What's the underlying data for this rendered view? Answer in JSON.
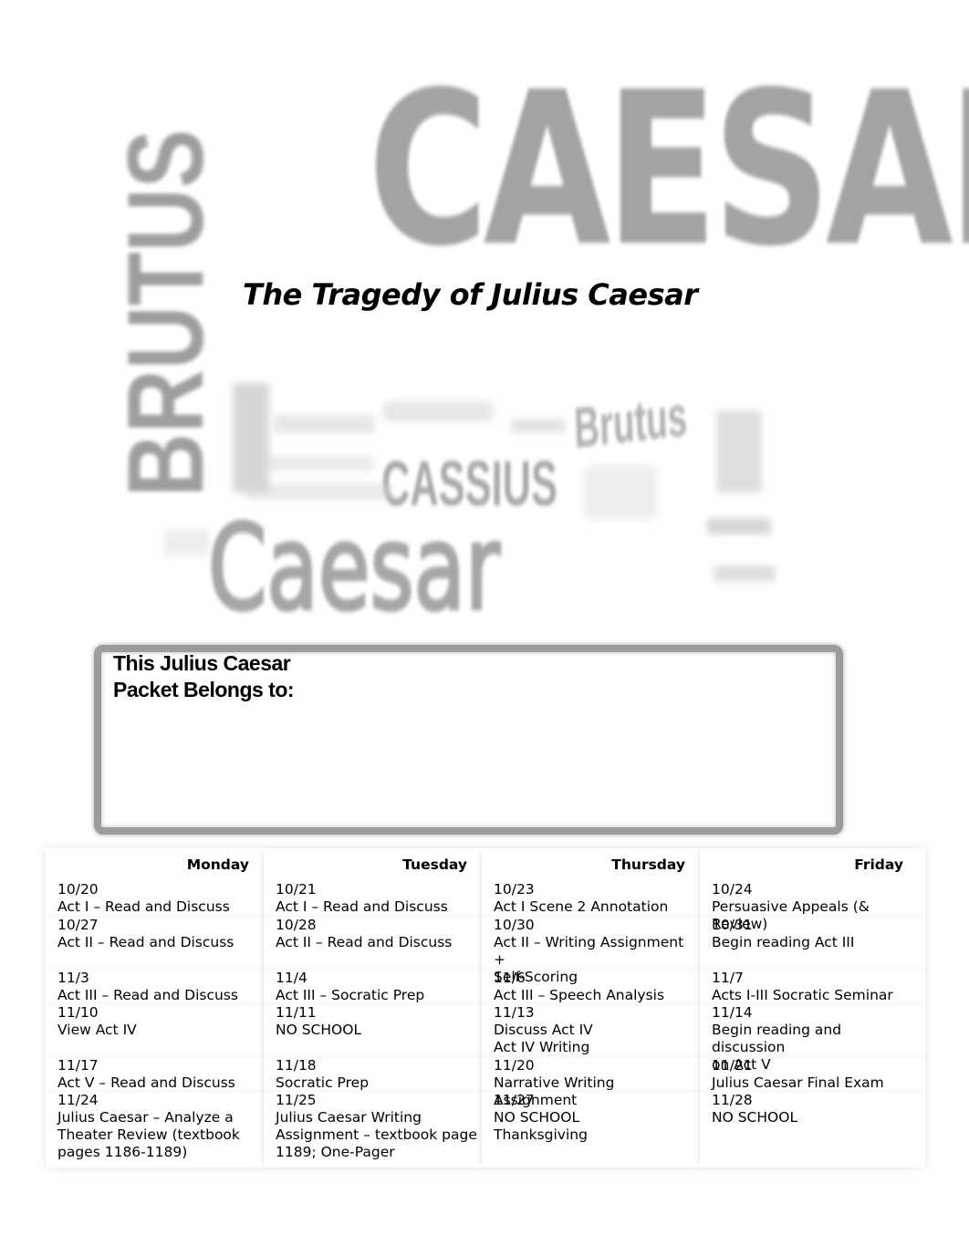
{
  "cover": {
    "word_cloud": {
      "large_top": "CAESAR",
      "vertical": "BRUTUS",
      "lower": "Caesar",
      "middle": "CASSIUS",
      "middle_small": "Brutus"
    },
    "title": "The Tragedy of Julius Caesar"
  },
  "name_box": {
    "label_line1": "This Julius Caesar",
    "label_line2": "Packet Belongs to:",
    "value": ""
  },
  "schedule": {
    "headers": [
      "Monday",
      "Tuesday",
      "Thursday",
      "Friday"
    ],
    "weeks": [
      {
        "days": [
          {
            "date": "10/20",
            "activity": "Act I – Read and Discuss"
          },
          {
            "date": "10/21",
            "activity": "Act I – Read and Discuss"
          },
          {
            "date": "10/23",
            "activity": "Act I Scene 2 Annotation"
          },
          {
            "date": "10/24",
            "activity": "Persuasive Appeals (& Review)"
          }
        ]
      },
      {
        "days": [
          {
            "date": "10/27",
            "activity": "Act II – Read and Discuss"
          },
          {
            "date": "10/28",
            "activity": "Act II – Read and Discuss"
          },
          {
            "date": "10/30",
            "activity": "Act II – Writing Assignment +\nSelf-Scoring"
          },
          {
            "date": "10/31",
            "activity": "Begin reading Act III"
          }
        ]
      },
      {
        "days": [
          {
            "date": "11/3",
            "activity": "Act III – Read and Discuss"
          },
          {
            "date": "11/4",
            "activity": "Act III – Socratic Prep"
          },
          {
            "date": "11/6",
            "activity": "Act III – Speech Analysis"
          },
          {
            "date": "11/7",
            "activity": "Acts I-III Socratic Seminar"
          }
        ]
      },
      {
        "days": [
          {
            "date": "11/10",
            "activity": "View Act IV"
          },
          {
            "date": "11/11",
            "activity": "NO SCHOOL"
          },
          {
            "date": "11/13",
            "activity": "Discuss Act IV\nAct IV Writing"
          },
          {
            "date": "11/14",
            "activity": "Begin reading and discussion\non Act V"
          }
        ]
      },
      {
        "days": [
          {
            "date": "11/17",
            "activity": "Act V – Read and Discuss"
          },
          {
            "date": "11/18",
            "activity": "Socratic Prep"
          },
          {
            "date": "11/20",
            "activity": "Narrative Writing Assignment"
          },
          {
            "date": "11/21",
            "activity": "Julius Caesar Final Exam"
          }
        ]
      },
      {
        "days": [
          {
            "date": "11/24",
            "activity": "Julius Caesar – Analyze a\nTheater Review (textbook\npages 1186-1189)"
          },
          {
            "date": "11/25",
            "activity": "Julius Caesar Writing\nAssignment – textbook page\n1189; One-Pager"
          },
          {
            "date": "11/27",
            "activity": "NO SCHOOL\nThanksgiving"
          },
          {
            "date": "11/28",
            "activity": "NO SCHOOL"
          }
        ]
      }
    ]
  }
}
